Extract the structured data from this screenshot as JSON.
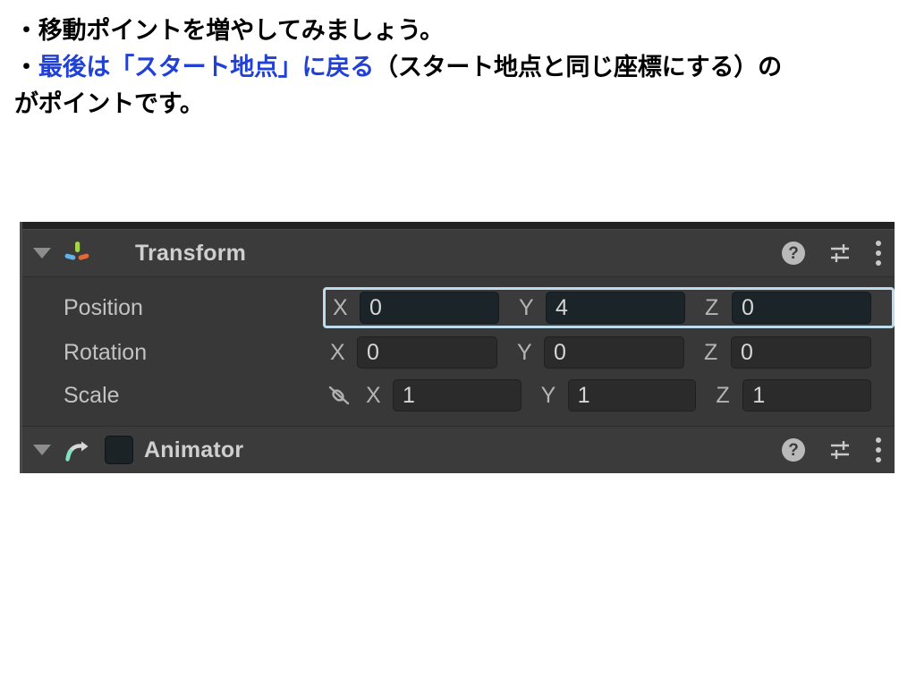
{
  "caption": {
    "line1": "・移動ポイントを増やしてみましょう。",
    "line2_bullet": "・",
    "line2_blue": "最後は「スタート地点」に戻る",
    "line2_black": "（スタート地点と同じ座標にする）の",
    "line3": "がポイントです。",
    "blue_color": "#2040d8",
    "text_color": "#000000"
  },
  "inspector": {
    "background_color": "#383838",
    "header_color": "#3b3b3b",
    "highlight_color": "#bcdced",
    "components": [
      {
        "name": "transform",
        "title": "Transform",
        "foldout_expanded": true,
        "icon": "transform-gizmo-icon",
        "has_enable_checkbox": false,
        "tools": [
          "help-icon",
          "preset-icon",
          "kebab-menu-icon"
        ],
        "properties": [
          {
            "label": "Position",
            "highlighted": true,
            "has_link_toggle": false,
            "axes": [
              {
                "label": "X",
                "value": "0"
              },
              {
                "label": "Y",
                "value": "4"
              },
              {
                "label": "Z",
                "value": "0"
              }
            ]
          },
          {
            "label": "Rotation",
            "highlighted": false,
            "has_link_toggle": false,
            "axes": [
              {
                "label": "X",
                "value": "0"
              },
              {
                "label": "Y",
                "value": "0"
              },
              {
                "label": "Z",
                "value": "0"
              }
            ]
          },
          {
            "label": "Scale",
            "highlighted": false,
            "has_link_toggle": true,
            "link_icon": "broken-link-icon",
            "axes": [
              {
                "label": "X",
                "value": "1"
              },
              {
                "label": "Y",
                "value": "1"
              },
              {
                "label": "Z",
                "value": "1"
              }
            ]
          }
        ]
      },
      {
        "name": "animator",
        "title": "Animator",
        "foldout_expanded": true,
        "icon": "animator-arrow-icon",
        "has_enable_checkbox": true,
        "enabled": false,
        "tools": [
          "help-icon",
          "preset-icon",
          "kebab-menu-icon"
        ]
      }
    ],
    "icon_glyphs": {
      "help": "?",
      "foldout": "▼"
    }
  }
}
